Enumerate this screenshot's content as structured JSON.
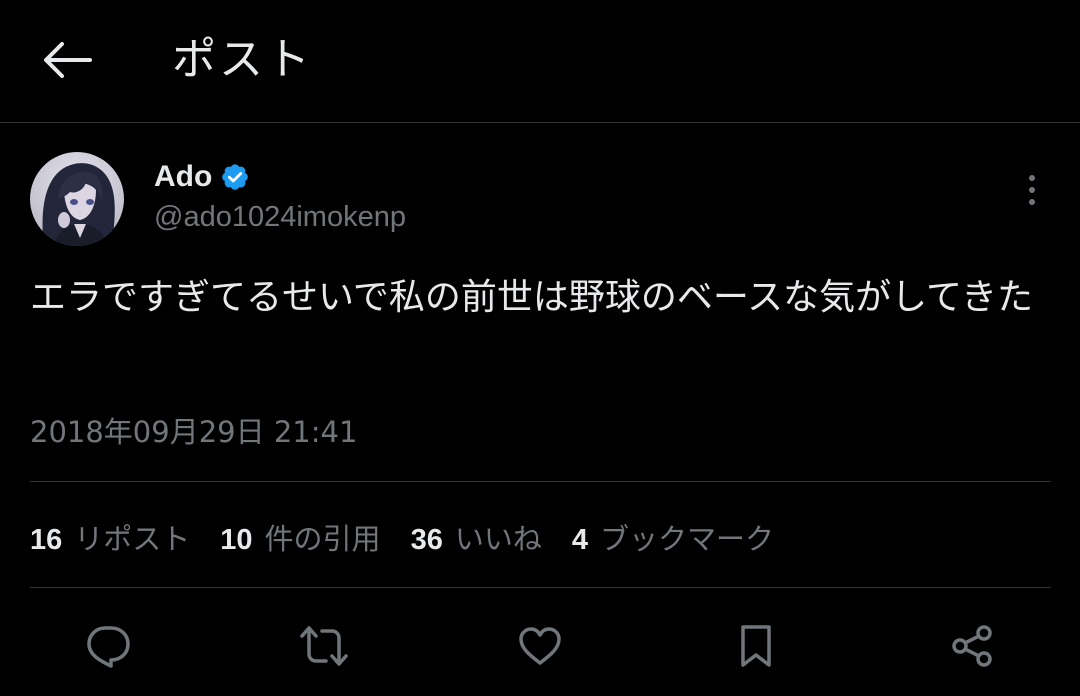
{
  "header": {
    "title": "ポスト",
    "back_icon": "arrow-left-icon"
  },
  "author": {
    "name": "Ado",
    "handle": "@ado1024imokenp",
    "verified": true,
    "verified_color": "#1d9bf0",
    "avatar": "anime-girl-avatar"
  },
  "post": {
    "text": "エラですぎてるせいで私の前世は野球のベースな気がしてきた",
    "timestamp": "2018年09月29日 21:41"
  },
  "stats": [
    {
      "count": "16",
      "label": "リポスト"
    },
    {
      "count": "10",
      "label": "件の引用"
    },
    {
      "count": "36",
      "label": "いいね"
    },
    {
      "count": "4",
      "label": "ブックマーク"
    }
  ],
  "actions": [
    {
      "name": "reply",
      "icon": "speech-bubble-icon"
    },
    {
      "name": "repost",
      "icon": "repost-arrows-icon"
    },
    {
      "name": "like",
      "icon": "heart-icon"
    },
    {
      "name": "bookmark",
      "icon": "bookmark-icon"
    },
    {
      "name": "share",
      "icon": "share-nodes-icon"
    }
  ],
  "colors": {
    "background": "#000000",
    "text_primary": "#e7e9ea",
    "text_secondary": "#71767b",
    "divider": "#2f3336",
    "accent": "#1d9bf0"
  }
}
